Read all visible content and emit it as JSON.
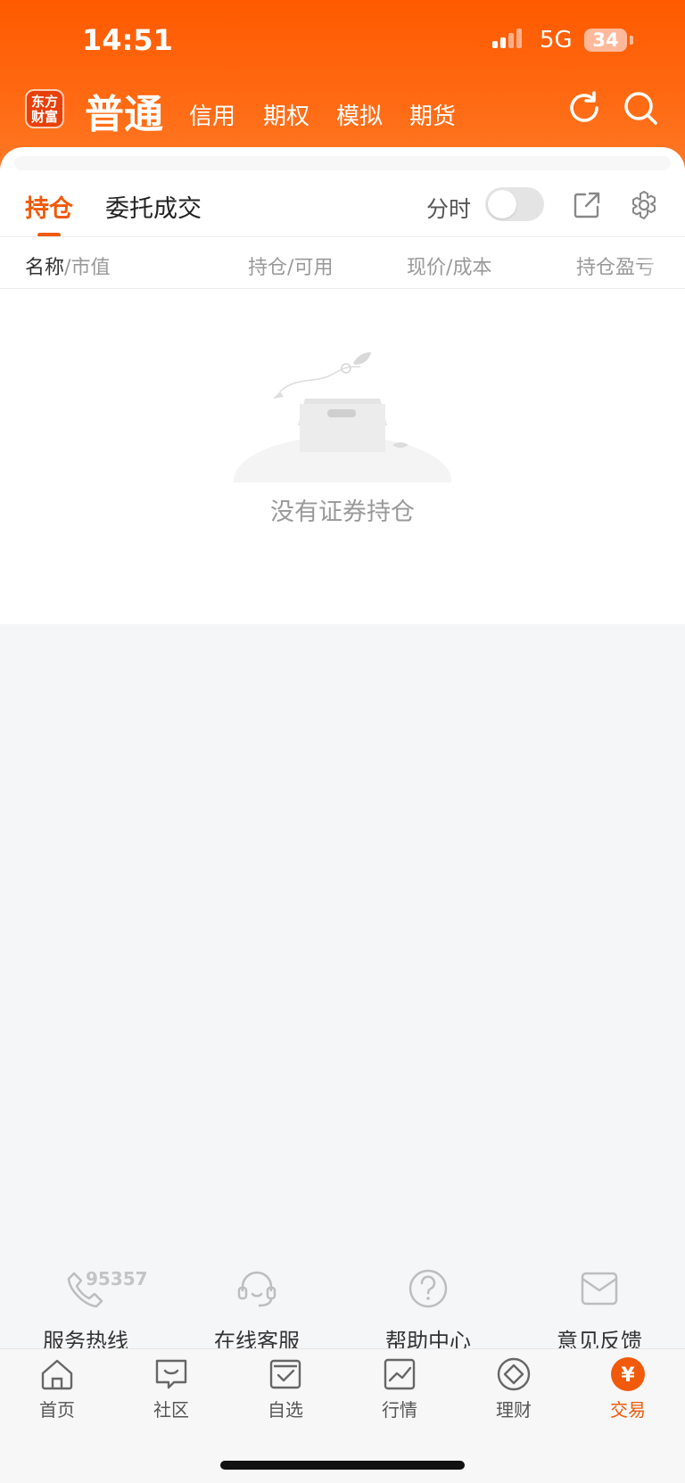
{
  "status_bar": {
    "time": "14:51",
    "network": "5G",
    "battery": "34"
  },
  "header": {
    "logo_line1": "东方",
    "logo_line2": "财富",
    "account_tabs": [
      "普通",
      "信用",
      "期权",
      "模拟",
      "期货"
    ]
  },
  "tabs": {
    "positions": "持仓",
    "orders": "委托成交"
  },
  "intraday": {
    "label": "分时",
    "enabled": false
  },
  "columns": {
    "name": "名称",
    "market_value": "市值",
    "holding": "持仓",
    "available": "可用",
    "price": "现价",
    "cost": "成本",
    "pnl": "持仓盈亏",
    "sep": "/"
  },
  "empty_message": "没有证券持仓",
  "services": {
    "hotline_number": "95357",
    "items": [
      "服务热线",
      "在线客服",
      "帮助中心",
      "意见反馈"
    ]
  },
  "tabbar": {
    "items": [
      "首页",
      "社区",
      "自选",
      "行情",
      "理财",
      "交易"
    ],
    "trade_glyph": "¥",
    "active_color": "#f05a0a"
  },
  "colors": {
    "brand": "#ff5a00",
    "accent": "#f05a0a"
  }
}
